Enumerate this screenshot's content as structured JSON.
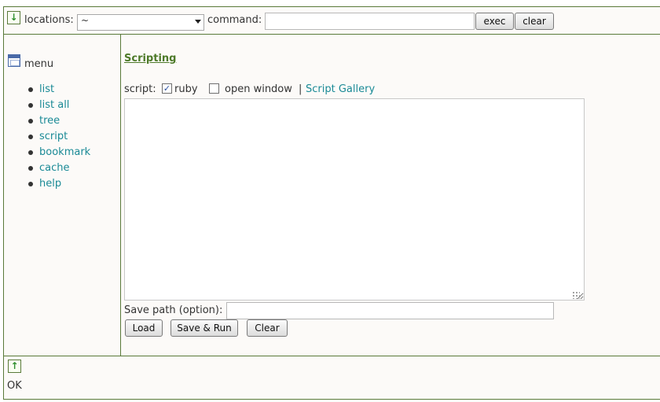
{
  "top_bar": {
    "locations_label": "locations:",
    "locations_value": "~",
    "command_label": "command:",
    "command_value": "",
    "exec_label": "exec",
    "clear_label": "clear"
  },
  "menu": {
    "title": "menu",
    "items": [
      {
        "label": "list"
      },
      {
        "label": "list all"
      },
      {
        "label": "tree"
      },
      {
        "label": "script"
      },
      {
        "label": "bookmark"
      },
      {
        "label": "cache"
      },
      {
        "label": "help"
      }
    ]
  },
  "main": {
    "heading": "Scripting",
    "script_label": "script:",
    "ruby_label": "ruby",
    "ruby_checked": true,
    "open_window_label": "open window",
    "open_window_checked": false,
    "separator": "|",
    "gallery_link": "Script Gallery",
    "script_text": "",
    "save_path_label": "Save path (option):",
    "save_path_value": "",
    "load_label": "Load",
    "save_run_label": "Save & Run",
    "clear_label": "Clear"
  },
  "bottom_bar": {
    "status": "OK"
  },
  "icons": {
    "down": "down-arrow-icon",
    "up": "up-arrow-icon",
    "menu": "window-icon"
  },
  "colors": {
    "link": "#1a8a96",
    "heading": "#4e7a2a",
    "border": "#5a7a3a",
    "panel_bg": "#fcfaf8"
  }
}
